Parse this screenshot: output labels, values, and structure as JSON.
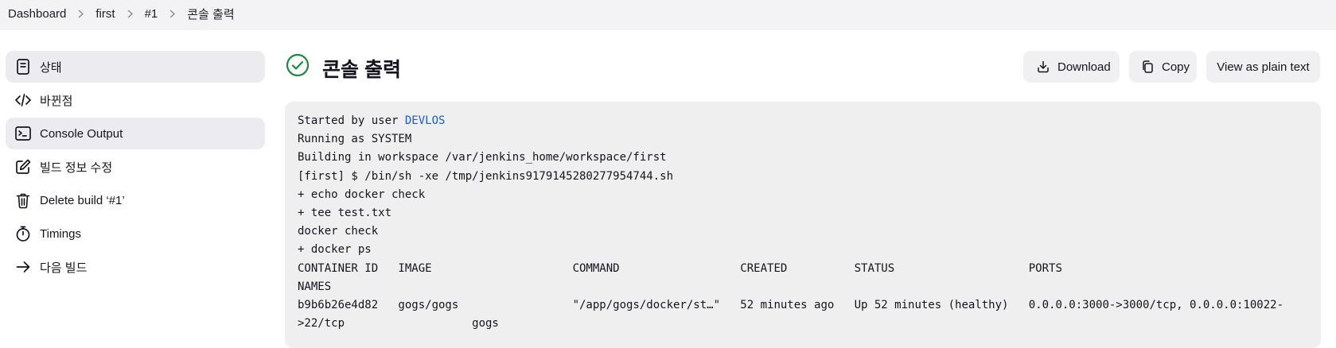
{
  "breadcrumb": [
    "Dashboard",
    "first",
    "#1",
    "콘솔 출력"
  ],
  "sidebar": {
    "items": [
      {
        "label": "상태",
        "icon": "document-icon",
        "active": true
      },
      {
        "label": "바뀐점",
        "icon": "code-icon",
        "active": false
      },
      {
        "label": "Console Output",
        "icon": "terminal-icon",
        "active": true
      },
      {
        "label": "빌드 정보 수정",
        "icon": "edit-icon",
        "active": false
      },
      {
        "label": "Delete build ‘#1’",
        "icon": "trash-icon",
        "active": false
      },
      {
        "label": "Timings",
        "icon": "stopwatch-icon",
        "active": false
      },
      {
        "label": "다음 빌드",
        "icon": "arrow-right-icon",
        "active": false
      }
    ]
  },
  "header": {
    "title": "콘솔 출력",
    "status_icon": "success-check-icon",
    "status_color": "#1e8a3c"
  },
  "actions": {
    "download": "Download",
    "copy": "Copy",
    "plain": "View as plain text"
  },
  "console": {
    "started_prefix": "Started by user ",
    "user": "DEVLOS",
    "lines": [
      "Running as SYSTEM",
      "Building in workspace /var/jenkins_home/workspace/first",
      "[first] $ /bin/sh -xe /tmp/jenkins9179145280277954744.sh",
      "+ echo docker check",
      "+ tee test.txt",
      "docker check",
      "+ docker ps",
      "CONTAINER ID   IMAGE                     COMMAND                  CREATED          STATUS                    PORTS",
      "NAMES",
      "b9b6b26e4d82   gogs/gogs                 \"/app/gogs/docker/st…\"   52 minutes ago   Up 52 minutes (healthy)   0.0.0.0:3000->3000/tcp, 0.0.0.0:10022-",
      ">22/tcp                   gogs"
    ]
  },
  "colors": {
    "accent_link": "#1d5ad6",
    "topbar_bg": "#f3f3f5",
    "active_item_bg": "#ececf0",
    "console_bg": "#efefef"
  }
}
